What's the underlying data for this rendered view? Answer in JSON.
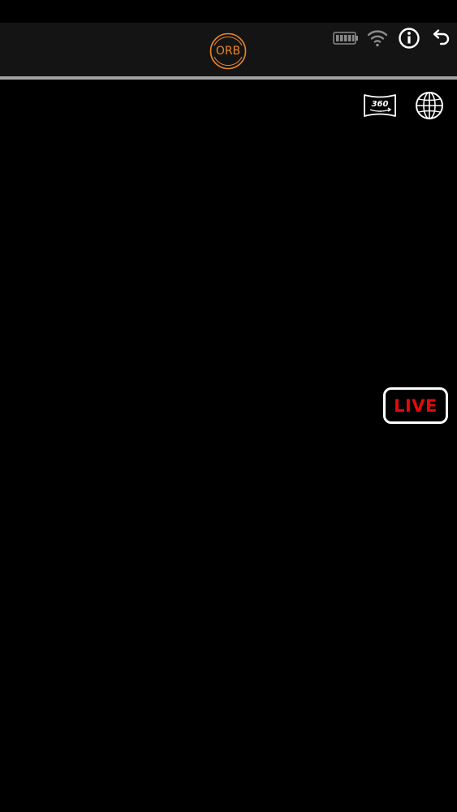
{
  "header": {
    "logo_text": "ORB",
    "logo_color": "#e9852a",
    "background": "#141414",
    "divider_color": "#a3a3a3",
    "status_icons": [
      {
        "name": "battery-icon"
      },
      {
        "name": "wifi-icon"
      },
      {
        "name": "info-icon"
      },
      {
        "name": "back-icon"
      }
    ]
  },
  "view_controls": {
    "view_360_icon_text": "360°",
    "globe_icon": "globe-icon"
  },
  "live_button": {
    "label": "LIVE",
    "text_color": "#e50a0a",
    "border_color": "#ffffff"
  },
  "viewport": {
    "background": "#000000"
  }
}
